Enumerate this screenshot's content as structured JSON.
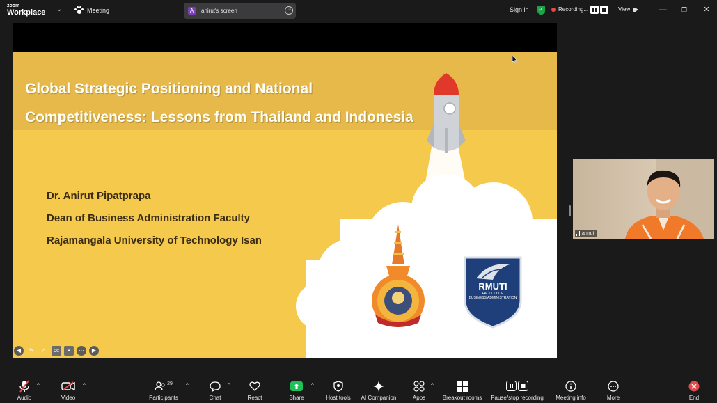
{
  "app": {
    "logo_small": "zoom",
    "logo_main": "Workplace",
    "meeting_label": "Meeting"
  },
  "screen_share": {
    "avatar_letter": "A",
    "name": "anirut's screen"
  },
  "top_right": {
    "signin": "Sign in",
    "recording": "Recording...",
    "view": "View"
  },
  "slide": {
    "title_line1": "Global Strategic Positioning and National",
    "title_line2": "Competitiveness: Lessons from Thailand and Indonesia",
    "presenter": "Dr. Anirut Pipatprapa",
    "position": "Dean of Business Administration Faculty",
    "university": "Rajamangala University of Technology Isan",
    "logo_text": "RMUTI",
    "logo_sub1": "FACULTY OF",
    "logo_sub2": "BUSINESS ADMINISTRATION",
    "colors": {
      "background": "#f5c94c",
      "title_band": "#e6b94a",
      "rocket_tip": "#e0392b",
      "text": "#3a2c12"
    }
  },
  "participant": {
    "name": "anirut"
  },
  "toolbar": {
    "audio": "Audio",
    "video": "Video",
    "participants": "Participants",
    "participants_count": "29",
    "chat": "Chat",
    "react": "React",
    "share": "Share",
    "host_tools": "Host tools",
    "ai_companion": "AI Companion",
    "apps": "Apps",
    "breakout_rooms": "Breakout rooms",
    "pause_stop_recording": "Pause/stop recording",
    "meeting_info": "Meeting info",
    "more": "More",
    "end": "End",
    "colors": {
      "share": "#1fbf5a",
      "end": "#e34b4b",
      "muted": "#e34b4b"
    }
  }
}
